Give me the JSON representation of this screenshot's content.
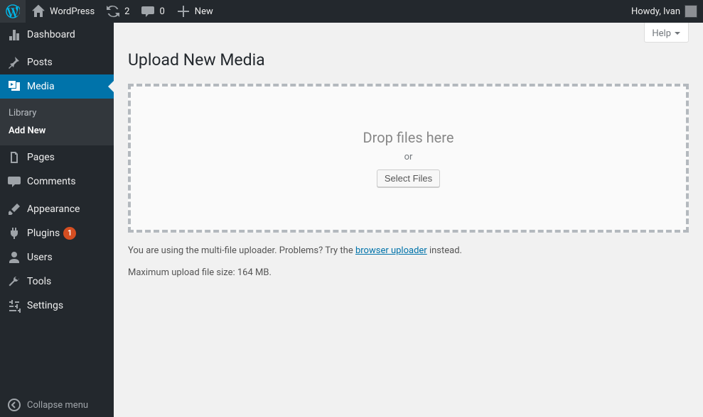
{
  "adminbar": {
    "site_name": "WordPress",
    "updates_count": "2",
    "comments_count": "0",
    "new_label": "New",
    "greeting": "Howdy, Ivan"
  },
  "sidebar": {
    "dashboard": "Dashboard",
    "posts": "Posts",
    "media": "Media",
    "media_sub": {
      "library": "Library",
      "add_new": "Add New"
    },
    "pages": "Pages",
    "comments": "Comments",
    "appearance": "Appearance",
    "plugins": "Plugins",
    "plugins_count": "1",
    "users": "Users",
    "tools": "Tools",
    "settings": "Settings",
    "collapse": "Collapse menu"
  },
  "screen": {
    "help": "Help"
  },
  "page": {
    "title": "Upload New Media",
    "drop_msg": "Drop files here",
    "or": "or",
    "select_btn": "Select Files",
    "hint_1": "You are using the multi-file uploader. Problems? Try the ",
    "hint_link": "browser uploader",
    "hint_2": " instead.",
    "max_size": "Maximum upload file size: 164 MB."
  }
}
